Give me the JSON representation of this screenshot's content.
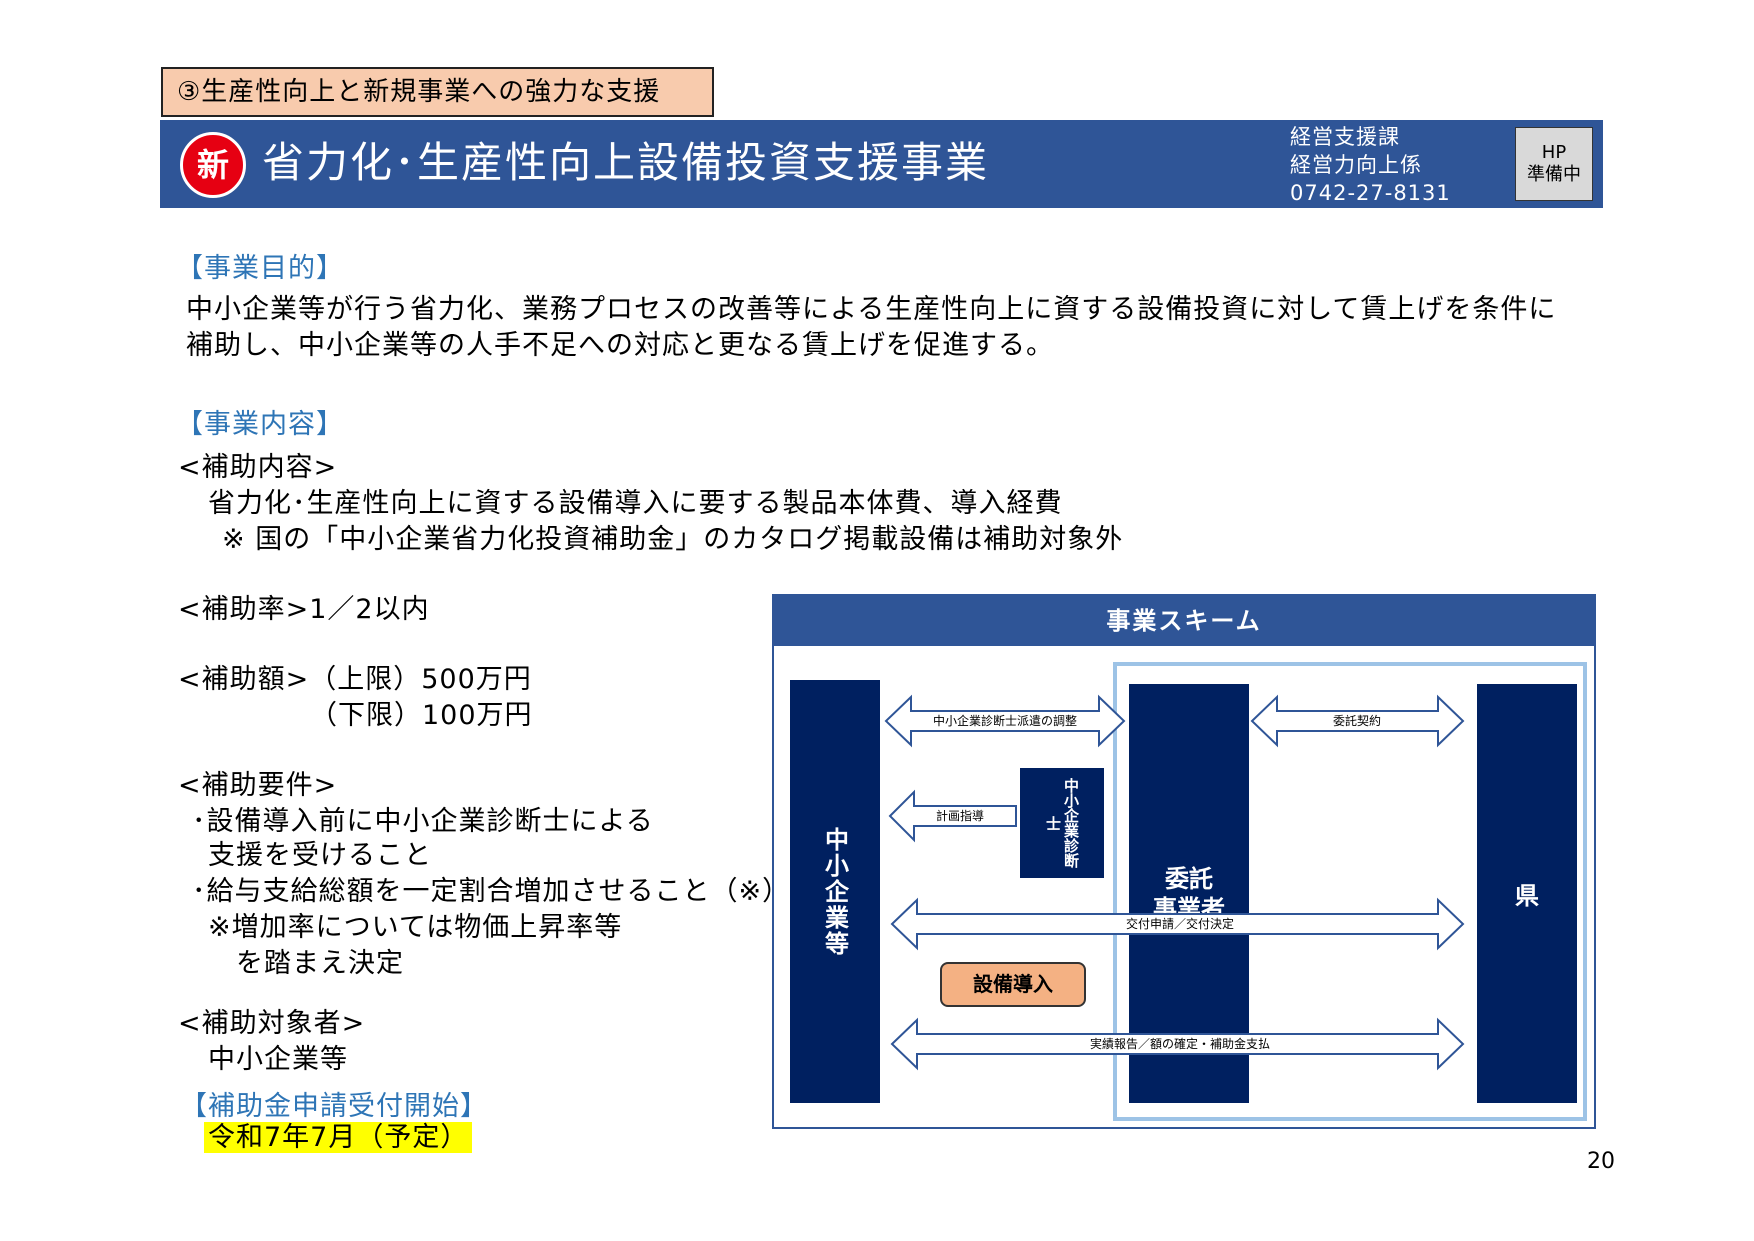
{
  "header": {
    "category": "③生産性向上と新規事業への強力な支援",
    "badge": "新",
    "title": "省力化･生産性向上設備投資支援事業",
    "contact": {
      "dept": "経営支援課",
      "section": "経営力向上係",
      "phone": "0742-27-8131"
    },
    "hp": {
      "line1": "HP",
      "line2": "準備中"
    }
  },
  "purpose": {
    "heading": "【事業目的】",
    "line1": "中小企業等が行う省力化、業務プロセスの改善等による生産性向上に資する設備投資に対して賃上げを条件に",
    "line2": "補助し、中小企業等の人手不足への対応と更なる賃上げを促進する。"
  },
  "content": {
    "heading": "【事業内容】",
    "subsidy_content": {
      "label": "<補助内容>",
      "line1": "省力化･生産性向上に資する設備導入に要する製品本体費、導入経費",
      "note": "※ 国の「中小企業省力化投資補助金」のカタログ掲載設備は補助対象外"
    },
    "rate": "<補助率>1／2以内",
    "amount": {
      "upper": "<補助額>（上限）500万円",
      "lower": "（下限）100万円"
    },
    "requirements": {
      "label": "<補助要件>",
      "item1a": "･設備導入前に中小企業診断士による",
      "item1b": "支援を受けること",
      "item2": "･給与支給総額を一定割合増加させること（※）",
      "note_a": "※増加率については物価上昇率等",
      "note_b": "を踏まえ決定"
    },
    "target": {
      "label": "<補助対象者>",
      "value": "中小企業等"
    },
    "application": {
      "heading": "【補助金申請受付開始】",
      "date": "令和7年7月（予定）"
    }
  },
  "scheme": {
    "title": "事業スキーム",
    "sme": "中小企業等",
    "consultant": "中小企業診断士",
    "contractor_line1": "委託",
    "contractor_line2": "事業者",
    "prefecture": "県",
    "arrows": {
      "dispatch": "中小企業診断士派遣の調整",
      "contract": "委託契約",
      "guidance": "計画指導",
      "grant": "交付申請／交付決定",
      "report": "実績報告／額の確定・補助金支払"
    },
    "equipment": "設備導入"
  },
  "page_number": "20"
}
